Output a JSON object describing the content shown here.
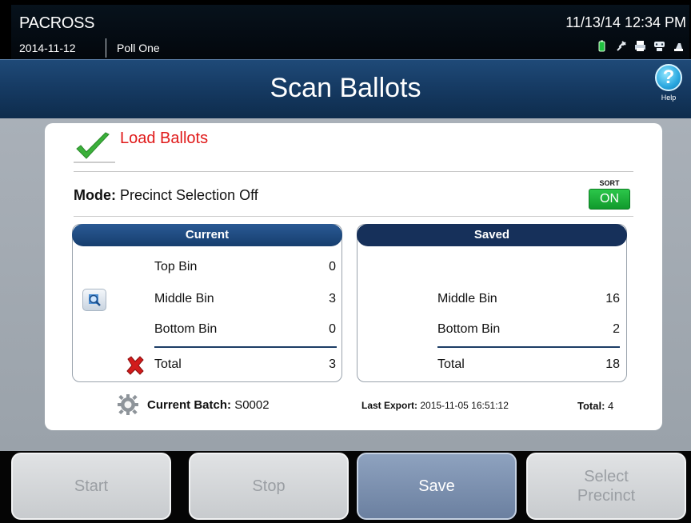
{
  "status_bar": {
    "app_name": "PACROSS",
    "date": "2014-11-12",
    "poll_name": "Poll One",
    "datetime": "11/13/14  12:34 PM",
    "icons": [
      "battery-icon",
      "plug-icon",
      "printer-icon",
      "modem-icon",
      "scanner-icon"
    ]
  },
  "title_bar": {
    "title": "Scan Ballots",
    "help_label": "Help"
  },
  "load_section": {
    "title": "Load Ballots",
    "mode_label": "Mode:",
    "mode_value": "Precinct Selection Off",
    "sort_label": "SORT",
    "sort_value": "ON"
  },
  "current_panel": {
    "header": "Current",
    "rows": [
      {
        "label": "Top Bin",
        "value": "0"
      },
      {
        "label": "Middle Bin",
        "value": "3"
      },
      {
        "label": "Bottom Bin",
        "value": "0"
      },
      {
        "label": "Total",
        "value": "3"
      }
    ]
  },
  "saved_panel": {
    "header": "Saved",
    "rows": [
      {
        "label": "Middle Bin",
        "value": "16"
      },
      {
        "label": "Bottom Bin",
        "value": "2"
      },
      {
        "label": "Total",
        "value": "18"
      }
    ]
  },
  "footer": {
    "batch_label": "Current Batch:",
    "batch_value": "S0002",
    "export_label": "Last Export:",
    "export_value": "2015-11-05 16:51:12",
    "total_label": "Total:",
    "total_value": "4"
  },
  "buttons": {
    "start": "Start",
    "stop": "Stop",
    "save": "Save",
    "select_precinct": "Select Precinct"
  },
  "colors": {
    "title_bar": "#163b64",
    "load_title": "#e01a1a",
    "sort_on": "#1aaa35",
    "panel_header_current": "#1f4a80",
    "panel_header_saved": "#16305a"
  }
}
